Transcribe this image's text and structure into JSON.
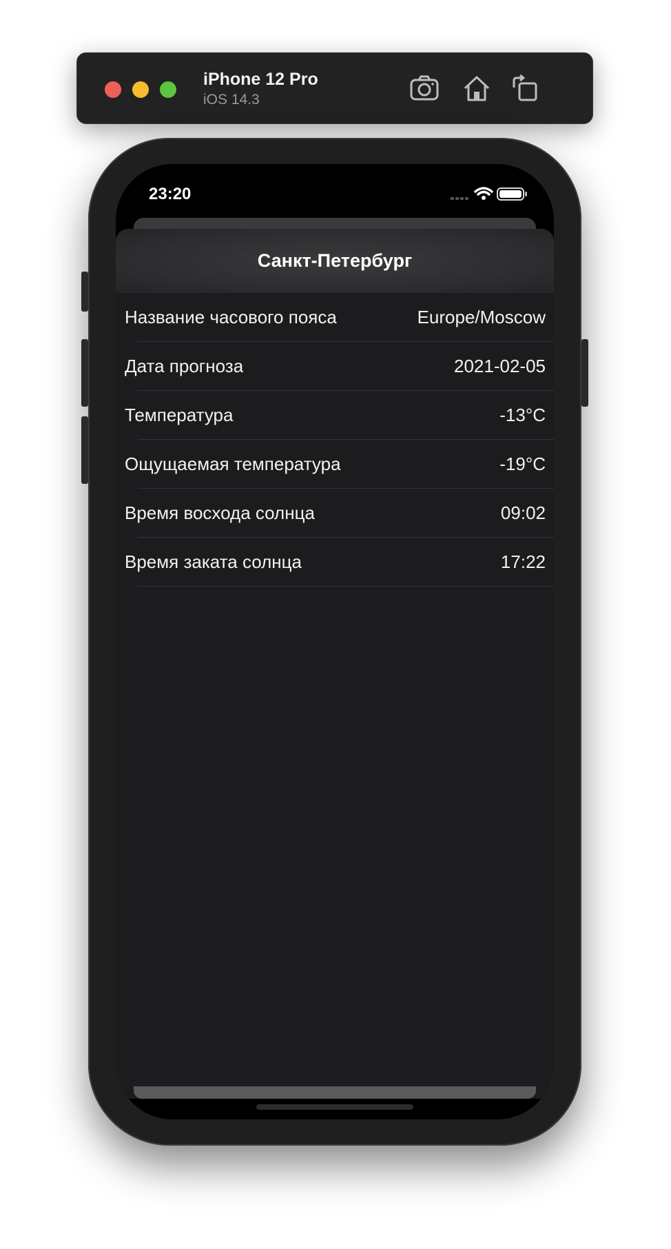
{
  "simulator": {
    "device_name": "iPhone 12 Pro",
    "os_version": "iOS 14.3",
    "icons": [
      "screenshot-icon",
      "home-icon",
      "rotate-icon"
    ]
  },
  "status_bar": {
    "time": "23:20"
  },
  "sheet": {
    "title": "Санкт-Петербург",
    "rows": [
      {
        "label": "Название часового пояса",
        "value": "Europe/Moscow"
      },
      {
        "label": "Дата прогноза",
        "value": "2021-02-05"
      },
      {
        "label": "Температура",
        "value": "-13°C"
      },
      {
        "label": "Ощущаемая температура",
        "value": "-19°C"
      },
      {
        "label": "Время восхода солнца",
        "value": "09:02"
      },
      {
        "label": "Время заката солнца",
        "value": "17:22"
      }
    ]
  }
}
